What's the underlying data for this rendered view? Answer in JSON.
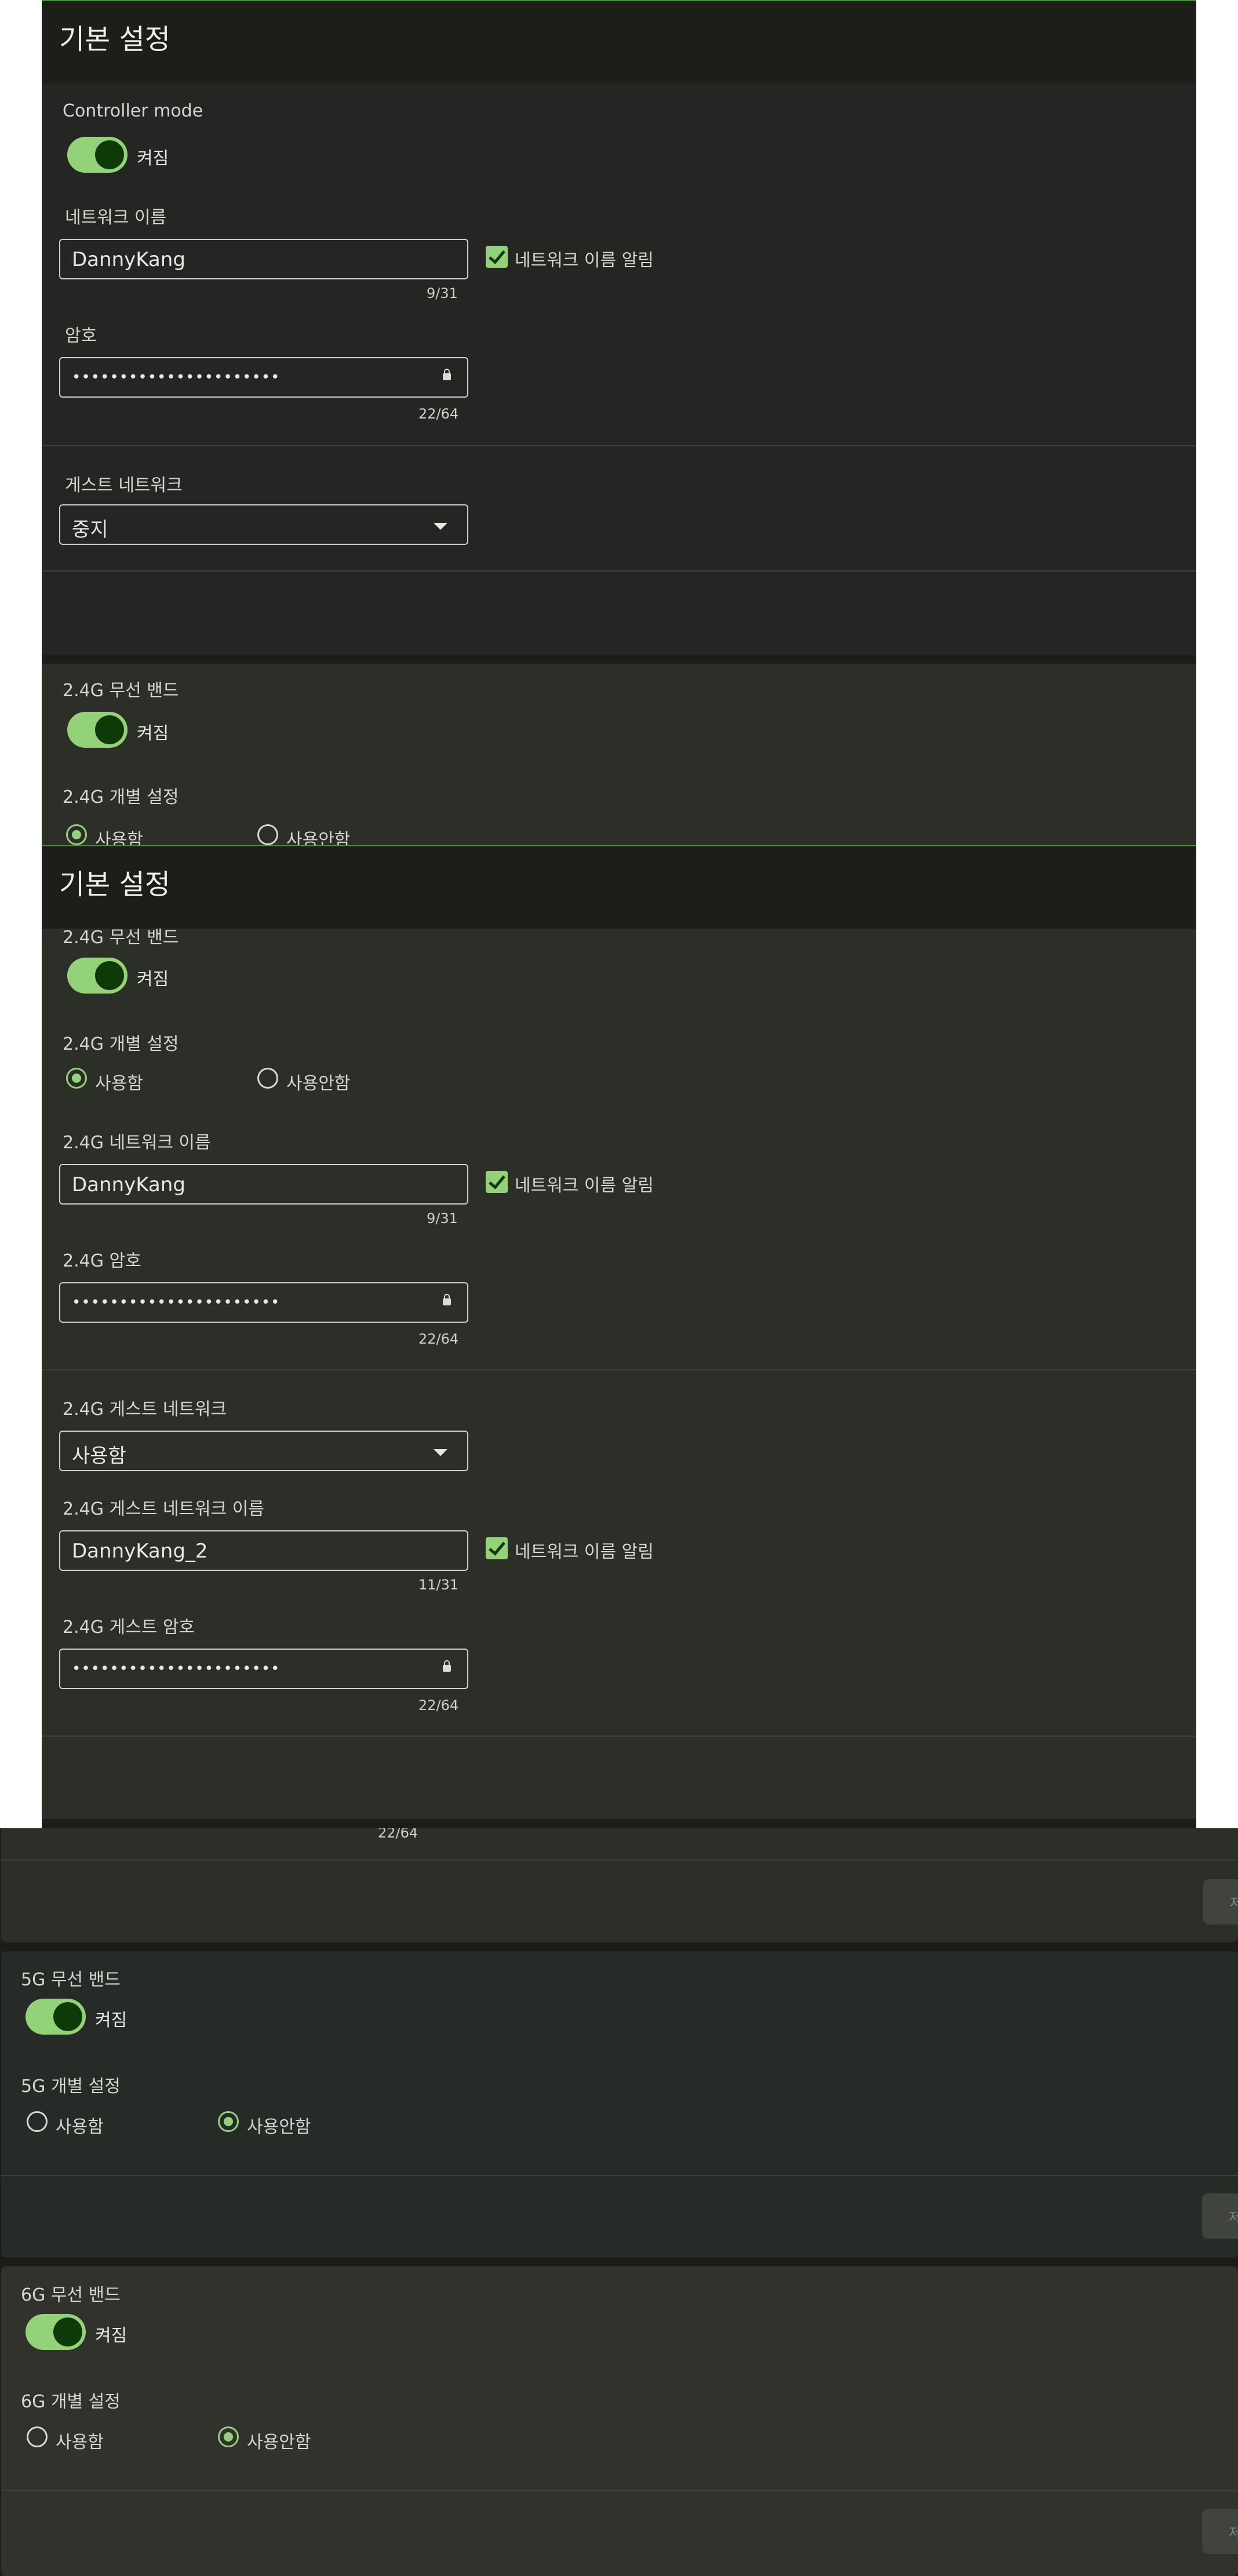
{
  "colors": {
    "accent": "#93d279",
    "header_bg": "#1c1e1a",
    "header_border": "#4e8f3b"
  },
  "panel1": {
    "title": "기본 설정",
    "controller_mode": {
      "label": "Controller mode",
      "state": "켜짐",
      "on": true
    },
    "network_name": {
      "label": "네트워크 이름",
      "value": "DannyKang",
      "counter": "9/31",
      "broadcast_label": "네트워크 이름 알림",
      "checked": true
    },
    "password": {
      "label": "암호",
      "value": "••••••••••••••••••••••",
      "counter": "22/64",
      "icon": "lock-icon"
    },
    "guest_network": {
      "label": "게스트 네트워크",
      "value": "중지",
      "icon": "dropdown-caret-icon"
    },
    "band24": {
      "label": "2.4G 무선 밴드",
      "state": "켜짐",
      "on": true
    },
    "band24_individual": {
      "label": "2.4G 개별 설정",
      "options": [
        "사용함",
        "사용안함"
      ],
      "selected": "사용함"
    }
  },
  "panel2": {
    "title": "기본 설정",
    "band24": {
      "label": "2.4G 무선 밴드",
      "state": "켜짐",
      "on": true
    },
    "band24_individual": {
      "label": "2.4G 개별 설정",
      "options": [
        "사용함",
        "사용안함"
      ],
      "selected": "사용함"
    },
    "network_name": {
      "label": "2.4G 네트워크 이름",
      "value": "DannyKang",
      "counter": "9/31",
      "broadcast_label": "네트워크 이름 알림",
      "checked": true
    },
    "password": {
      "label": "2.4G 암호",
      "value": "••••••••••••••••••••••",
      "counter": "22/64"
    },
    "guest_network": {
      "label": "2.4G 게스트 네트워크",
      "value": "사용함"
    },
    "guest_name": {
      "label": "2.4G 게스트 네트워크 이름",
      "value": "DannyKang_2",
      "counter": "11/31",
      "broadcast_label": "네트워크 이름 알림",
      "checked": true
    },
    "guest_password": {
      "label": "2.4G 게스트 암호",
      "value": "••••••••••••••••••••••",
      "counter": "22/64"
    }
  },
  "panel3": {
    "partial_counter": "22/64",
    "save_stub": "저",
    "band5": {
      "label": "5G 무선 밴드",
      "state": "켜짐",
      "on": true
    },
    "band5_individual": {
      "label": "5G 개별 설정",
      "options": [
        "사용함",
        "사용안함"
      ],
      "selected": "사용안함"
    },
    "band6": {
      "label": "6G 무선 밴드",
      "state": "켜짐",
      "on": true
    },
    "band6_individual": {
      "label": "6G 개별 설정",
      "options": [
        "사용함",
        "사용안함"
      ],
      "selected": "사용안함"
    }
  }
}
